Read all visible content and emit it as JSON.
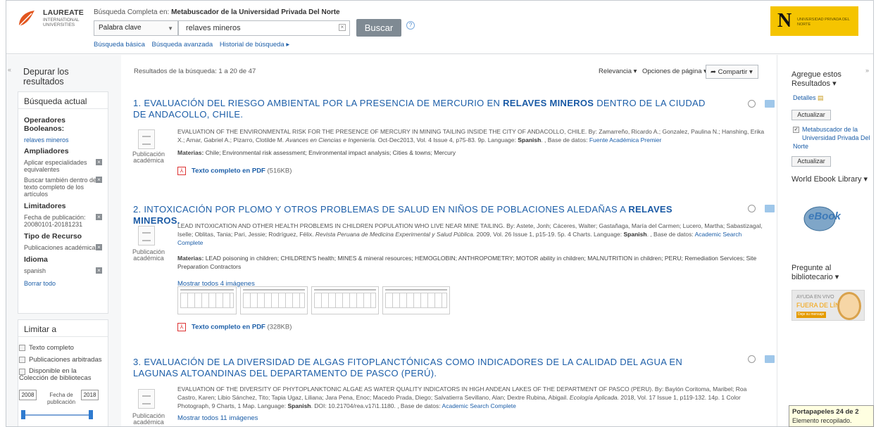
{
  "header": {
    "logo": {
      "name": "LAUREATE",
      "sub": "INTERNATIONAL UNIVERSITIES"
    },
    "search_label_prefix": "Búsqueda Completa en:",
    "search_label_db": "Metabuscador de la Universidad Privada Del Norte",
    "field_select": "Palabra clave",
    "search_value": "relaves mineros",
    "search_button": "Buscar",
    "links": [
      "Búsqueda básica",
      "Búsqueda avanzada",
      "Historial de búsqueda ▸"
    ],
    "brand": {
      "letter": "N",
      "text": "UNIVERSIDAD PRIVADA DEL NORTE"
    }
  },
  "left": {
    "title": "Depurar los resultados",
    "current": {
      "title": "Búsqueda actual",
      "operators_head": "Operadores Booleanos:",
      "operators_value": "relaves mineros",
      "expanders_head": "Ampliadores",
      "expander1": "Aplicar especialidades equivalentes",
      "expander2": "Buscar también dentro del texto completo de los artículos",
      "limiters_head": "Limitadores",
      "limiter1": "Fecha de publicación: 20080101-20181231",
      "resource_head": "Tipo de Recurso",
      "resource1": "Publicaciones académicas",
      "language_head": "Idioma",
      "language1": "spanish",
      "clear_all": "Borrar todo"
    },
    "limit": {
      "title": "Limitar a",
      "fulltext": "Texto completo",
      "peer": "Publicaciones arbitradas",
      "library": "Disponible en la Colección de bibliotecas",
      "date_from": "2008",
      "date_to": "2018",
      "date_label": "Fecha de publicación"
    }
  },
  "results": {
    "count": "Resultados de la búsqueda: 1 a 20 de 47",
    "relevance": "Relevancia ▾",
    "page_options": "Opciones de página ▾",
    "share": "Compartir ▾",
    "items": [
      {
        "title": "1. Evaluación del riesgo ambiental por la presencia de mercurio en ",
        "highlight": "RELAVES MINEROS",
        "title_end": " dentro de la ciudad de Andacollo, Chile.",
        "type": "Publicación académica",
        "body": "EVALUATION OF THE ENVIRONMENTAL RISK FOR THE PRESENCE OF MERCURY IN MINING TAILING INSIDE THE CITY OF ANDACOLLO, CHILE. By: Zamarreño, Ricardo A.; Gonzalez, Paulina N.; Hanshing, Erika X.; Arnar, Gabriel A.; Pizarro, Clotilde M.",
        "journal": "Avances en Ciencias e Ingeniería.",
        "body2": "Oct-Dec2013, Vol. 4 Issue 4, p75-83. 9p. Language:",
        "lang": "Spanish",
        "db_prefix": ". , Base de datos:",
        "db": "Fuente Académica Premier",
        "subjects_label": "Materias:",
        "subjects": "Chile; Environmental risk assessment; Environmental impact analysis; Cities & towns; Mercury",
        "pdf": "Texto completo en PDF",
        "pdf_size": "(516KB)"
      },
      {
        "title": "2. Intoxicación por plomo y otros problemas de salud en niños de poblaciones aledañas a ",
        "highlight": "RELAVES MINEROS.",
        "title_end": "",
        "type": "Publicación académica",
        "body": "LEAD INTOXICATION AND OTHER HEALTH PROBLEMS IN CHILDREN POPULATION WHO LIVE NEAR MINE TAILING. By: Astete, Jonh; Cáceres, Walter; Gastañaga, María del Carmen; Lucero, Martha; Sabastizagal, Iselle; Oblitas, Tania; Pari, Jessie; Rodríguez, Félix.",
        "journal": "Revista Peruana de Medicina Experimental y Salud Pública.",
        "body2": "2009, Vol. 26 Issue 1, p15-19. 5p. 4 Charts. Language:",
        "lang": "Spanish",
        "db_prefix": ". , Base de datos:",
        "db": "Academic Search Complete",
        "subjects_label": "Materias:",
        "subjects": "LEAD poisoning in children; CHILDREN'S health; MINES & mineral resources; HEMOGLOBIN; ANTHROPOMETRY; MOTOR ability in children; MALNUTRITION in children; PERU; Remediation Services; Site Preparation Contractors",
        "images_link": "Mostrar todos 4 imágenes",
        "pdf": "Texto completo en PDF",
        "pdf_size": "(328KB)"
      },
      {
        "title": "3. Evaluación de la diversidad de algas fitoplanctónicas como indicadores de la calidad del agua en lagunas altoandinas del departamento de Pasco (Perú).",
        "type": "Publicación académica",
        "body": "EVALUATION OF THE DIVERSITY OF PHYTOPLANKTONIC ALGAE AS WATER QUALITY INDICATORS IN HIGH ANDEAN LAKES OF THE DEPARTMENT OF PASCO (PERU). By: Baylón Coritoma, Maribel; Roa Castro, Karen; Libio Sánchez, Tito; Tapia Ugaz, Liliana; Jara Pena, Enoc; Macedo Prada, Diego; Salvatierra Sevillano, Alan; Dextre Rubina, Abigail.",
        "journal": "Ecología Aplicada.",
        "body2": "2018, Vol. 17 Issue 1, p119-132. 14p. 1 Color Photograph, 9 Charts, 1 Map. Language:",
        "lang": "Spanish",
        "db_prefix": ". DOI: 10.21704/rea.v17i1.1180. , Base de datos:",
        "db": "Academic Search Complete",
        "images_link": "Mostrar todos 11 imágenes"
      }
    ]
  },
  "right": {
    "add_title": "Agregue estos Resultados ▾",
    "details": "Detalles",
    "update": "Actualizar",
    "meta_check": "Metabuscador de la Universidad Privada Del Norte",
    "update2": "Actualizar",
    "ebook_title": "World Ebook Library ▾",
    "ebook_logo": "eBook",
    "ask_title": "Pregunte al bibliotecario ▾",
    "chat_t1": "AYUDA EN VIVO",
    "chat_t2": "FUERA DE LÍNEA",
    "chat_t3": "Deje su mensaje"
  },
  "clipboard": {
    "title": "Portapapeles 24 de 2",
    "text": "Elemento recopilado."
  }
}
